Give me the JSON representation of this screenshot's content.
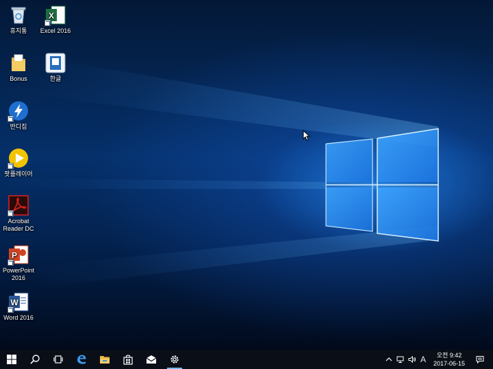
{
  "desktop": {
    "icons": [
      {
        "label": "휴지통",
        "icon": "recycle-bin-icon"
      },
      {
        "label": "Excel 2016",
        "icon": "excel-icon"
      },
      {
        "label": "Bonus",
        "icon": "folder-icon"
      },
      {
        "label": "한글",
        "icon": "hangul-icon"
      },
      {
        "label": "반디집",
        "icon": "bandizip-icon"
      },
      {
        "label": "팟플레이어",
        "icon": "potplayer-icon"
      },
      {
        "label": "Acrobat Reader DC",
        "icon": "acrobat-icon"
      },
      {
        "label": "PowerPoint 2016",
        "icon": "powerpoint-icon"
      },
      {
        "label": "Word 2016",
        "icon": "word-icon"
      }
    ]
  },
  "taskbar": {
    "buttons": [
      "start-icon",
      "search-icon",
      "task-view-icon",
      "edge-icon",
      "file-explorer-icon",
      "store-icon",
      "mail-icon",
      "settings-icon"
    ],
    "tray": {
      "ime_indicator": "A",
      "time": "오전 9:42",
      "date": "2017-06-15"
    }
  },
  "colors": {
    "taskbar_bg": "#0a0f17",
    "accent": "#76b9ed",
    "wallpaper_light": "#3aa0ff"
  }
}
